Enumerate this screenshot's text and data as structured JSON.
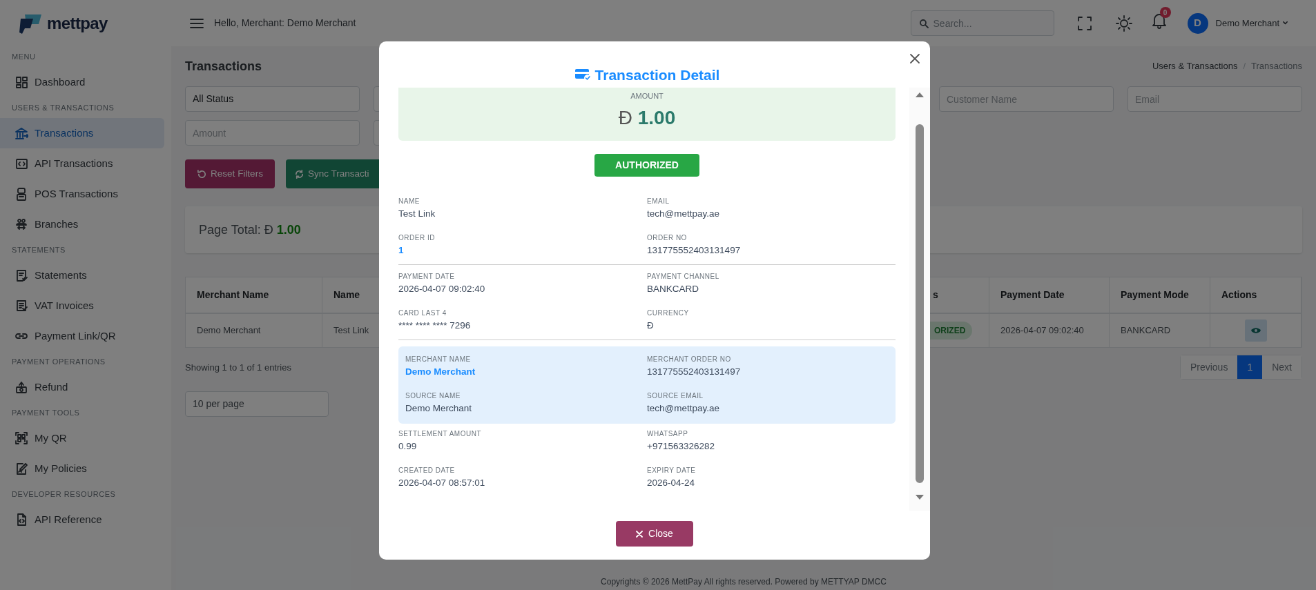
{
  "logo": {
    "text": "mettpay"
  },
  "sidebar": {
    "items": [
      {
        "kind": "section",
        "label": "MENU"
      },
      {
        "kind": "link",
        "label": "Dashboard",
        "selected": false
      },
      {
        "kind": "section",
        "label": "USERS & TRANSACTIONS"
      },
      {
        "kind": "link",
        "label": "Transactions",
        "selected": true
      },
      {
        "kind": "link",
        "label": "API Transactions",
        "selected": false
      },
      {
        "kind": "link",
        "label": "POS Transactions",
        "selected": false
      },
      {
        "kind": "link",
        "label": "Branches",
        "selected": false
      },
      {
        "kind": "section",
        "label": "STATEMENTS"
      },
      {
        "kind": "link",
        "label": "Statements",
        "selected": false
      },
      {
        "kind": "link",
        "label": "VAT Invoices",
        "selected": false
      },
      {
        "kind": "link",
        "label": "Payment Link/QR",
        "selected": false
      },
      {
        "kind": "section",
        "label": "PAYMENT OPERATIONS"
      },
      {
        "kind": "link",
        "label": "Refund",
        "selected": false
      },
      {
        "kind": "section",
        "label": "PAYMENT TOOLS"
      },
      {
        "kind": "link",
        "label": "My QR",
        "selected": false
      },
      {
        "kind": "link",
        "label": "My Policies",
        "selected": false
      },
      {
        "kind": "section",
        "label": "DEVELOPER RESOURCES"
      },
      {
        "kind": "link",
        "label": "API Reference",
        "selected": false
      }
    ]
  },
  "topbar": {
    "greeting": "Hello, Merchant: Demo Merchant",
    "search": {
      "placeholder": "Search..."
    },
    "notifications": "0",
    "avatar": "D",
    "user": "Demo Merchant"
  },
  "page": {
    "title": "Transactions",
    "breadcrumb": [
      "Users & Transactions",
      "Transactions"
    ],
    "breadcrumb_separator": "/",
    "filters": [
      {
        "kind": "select",
        "value": "All Status"
      },
      {
        "kind": "blank"
      },
      {
        "kind": "gap"
      },
      {
        "kind": "gap"
      },
      {
        "kind": "input",
        "placeholder": "Customer Name"
      },
      {
        "kind": "input",
        "placeholder": "Email"
      },
      {
        "kind": "input",
        "placeholder": "Amount"
      },
      {
        "kind": "blank"
      }
    ],
    "buttons": [
      {
        "kind": "reset",
        "label": "Reset Filters"
      },
      {
        "kind": "sync",
        "label": "Sync Transacti"
      }
    ],
    "page_total": {
      "label": "Page Total:",
      "currency": "Đ",
      "value": "1.00"
    },
    "table": {
      "columns": [
        "Merchant Name",
        "Name",
        "s",
        "Payment Date",
        "Payment Mode",
        "Actions"
      ],
      "rows": [
        {
          "cells": [
            "Demo Merchant",
            "Test Link",
            "ORIZED",
            "2026-04-07 09:02:40",
            "BANKCARD"
          ]
        }
      ]
    },
    "showing": "Showing 1 to 1 of 1 entries",
    "pagination": [
      {
        "label": "Previous",
        "selected": false
      },
      {
        "label": "1",
        "selected": true
      },
      {
        "label": "Next",
        "selected": false
      }
    ],
    "per_page": "10 per page"
  },
  "footer": "Copyrights © 2026 MettPay All rights reserved. Powered by METTYAP DMCC",
  "modal": {
    "title": "Transaction Detail",
    "amount": {
      "label": "AMOUNT",
      "currency": "Đ",
      "value": "1.00"
    },
    "status": {
      "label": "AUTHORIZED",
      "kind": "success"
    },
    "sections": [
      {
        "kind": "plain",
        "fields": [
          {
            "label": "NAME",
            "value": "Test Link",
            "kind": "text"
          },
          {
            "label": "EMAIL",
            "value": "tech@mettpay.ae",
            "kind": "text"
          },
          {
            "label": "ORDER ID",
            "value": "1",
            "kind": "link"
          },
          {
            "label": "ORDER NO",
            "value": "131775552403131497",
            "kind": "text"
          }
        ]
      },
      {
        "kind": "plain",
        "fields": [
          {
            "label": "PAYMENT DATE",
            "value": "2026-04-07 09:02:40",
            "kind": "text"
          },
          {
            "label": "PAYMENT CHANNEL",
            "value": "BANKCARD",
            "kind": "text"
          },
          {
            "label": "CARD LAST 4",
            "value": "**** **** **** 7296",
            "kind": "text"
          },
          {
            "label": "CURRENCY",
            "value": "Đ",
            "kind": "text"
          }
        ]
      },
      {
        "kind": "highlight",
        "fields": [
          {
            "label": "MERCHANT NAME",
            "value": "Demo Merchant",
            "kind": "link"
          },
          {
            "label": "MERCHANT ORDER NO",
            "value": "131775552403131497",
            "kind": "text"
          },
          {
            "label": "SOURCE NAME",
            "value": "Demo Merchant",
            "kind": "text"
          },
          {
            "label": "SOURCE EMAIL",
            "value": "tech@mettpay.ae",
            "kind": "text"
          }
        ]
      },
      {
        "kind": "plain",
        "fields": [
          {
            "label": "SETTLEMENT AMOUNT",
            "value": "0.99",
            "kind": "text"
          },
          {
            "label": "WHATSAPP",
            "value": "+971563326282",
            "kind": "text"
          },
          {
            "label": "CREATED DATE",
            "value": "2026-04-07 08:57:01",
            "kind": "text"
          },
          {
            "label": "EXPIRY DATE",
            "value": "2026-04-24",
            "kind": "text"
          }
        ]
      }
    ],
    "close_button": "Close"
  }
}
